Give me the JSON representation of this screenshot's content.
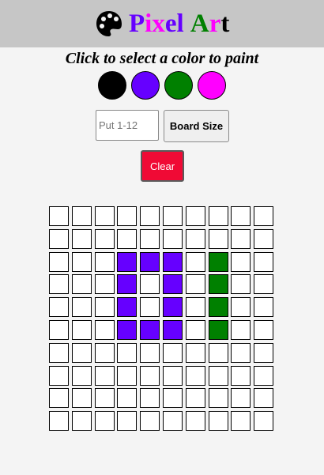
{
  "header": {
    "icon": "palette-icon",
    "title_letters": [
      {
        "char": "P",
        "color": "#6600ff"
      },
      {
        "char": "i",
        "color": "#ff00ff"
      },
      {
        "char": "x",
        "color": "#ff00ff"
      },
      {
        "char": "e",
        "color": "#6600ff"
      },
      {
        "char": "l",
        "color": "#6600ff"
      },
      {
        "char": " ",
        "color": "#000000"
      },
      {
        "char": "A",
        "color": "#008000"
      },
      {
        "char": "r",
        "color": "#ff00ff"
      },
      {
        "char": "t",
        "color": "#000000"
      }
    ]
  },
  "instructions": "Click to select a color to paint",
  "palette": [
    {
      "name": "black",
      "color": "#000000"
    },
    {
      "name": "purple",
      "color": "#6600ff"
    },
    {
      "name": "green",
      "color": "#008000"
    },
    {
      "name": "magenta",
      "color": "#ff00ff"
    }
  ],
  "board_size_input": {
    "value": "",
    "placeholder": "Put 1-12"
  },
  "board_size_button": "Board Size",
  "clear_button": "Clear",
  "board": {
    "rows": 10,
    "cols": 10,
    "colors": {
      "P": "#6600ff",
      "G": "#008000",
      "W": "#ffffff"
    },
    "grid": [
      "WWWWWWWWWW",
      "WWWWWWWWWW",
      "WWWPPPWGWW",
      "WWWPWPWGWW",
      "WWWPWPWGWW",
      "WWWPPPWGWW",
      "WWWWWWWWWW",
      "WWWWWWWWWW",
      "WWWWWWWWWW",
      "WWWWWWWWWW"
    ]
  }
}
